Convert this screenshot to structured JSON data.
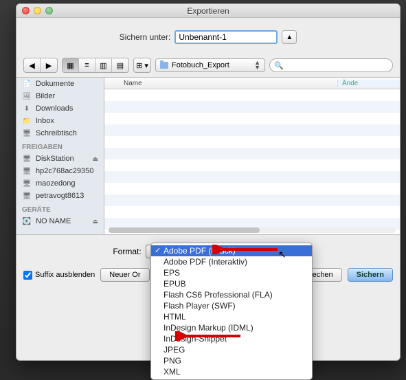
{
  "window": {
    "title": "Exportieren"
  },
  "save": {
    "label": "Sichern unter:",
    "filename": "Unbenannt-1"
  },
  "path": {
    "folder": "Fotobuch_Export"
  },
  "search": {
    "placeholder": ""
  },
  "sidebar": {
    "favorites": [
      {
        "icon": "doc",
        "label": "Dokumente"
      },
      {
        "icon": "pic",
        "label": "Bilder"
      },
      {
        "icon": "dl",
        "label": "Downloads"
      },
      {
        "icon": "folder",
        "label": "Inbox"
      },
      {
        "icon": "desk",
        "label": "Schreibtisch"
      }
    ],
    "shared_header": "FREIGABEN",
    "shared": [
      {
        "icon": "srv",
        "label": "DiskStation",
        "eject": true
      },
      {
        "icon": "srv",
        "label": "hp2c768ac29350"
      },
      {
        "icon": "srv",
        "label": "maozedong"
      },
      {
        "icon": "srv",
        "label": "petravogt8613"
      }
    ],
    "devices_header": "GERÄTE",
    "devices": [
      {
        "icon": "disk",
        "label": "NO NAME",
        "eject": true
      }
    ]
  },
  "list": {
    "col_name": "Name",
    "col_mod": "Ände"
  },
  "format": {
    "label": "Format:",
    "selected": "Adobe PDF (Druck)",
    "options": [
      "Adobe PDF (Druck)",
      "Adobe PDF (Interaktiv)",
      "EPS",
      "EPUB",
      "Flash CS6 Professional (FLA)",
      "Flash Player (SWF)",
      "HTML",
      "InDesign Markup (IDML)",
      "InDesign-Snippet",
      "JPEG",
      "PNG",
      "XML"
    ],
    "highlighted_index": 0
  },
  "buttons": {
    "suffix_label": "Suffix ausblenden",
    "newfolder": "Neuer Or",
    "cancel": "Abbrechen",
    "save": "Sichern"
  },
  "annotations": {
    "arrow_to_selected": "Adobe PDF (Druck)",
    "arrow_to_jpeg": "JPEG"
  }
}
